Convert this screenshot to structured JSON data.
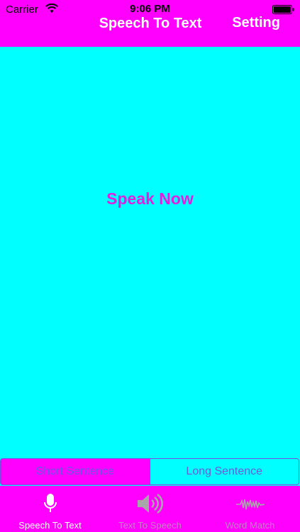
{
  "status_bar": {
    "carrier": "Carrier",
    "time": "9:06 PM"
  },
  "nav": {
    "title": "Speech To Text",
    "setting_label": "Setting"
  },
  "main": {
    "speak_now": "Speak Now"
  },
  "segmented_control": {
    "options": [
      "Short Sentence",
      "Long Sentence"
    ],
    "selected_index": 0
  },
  "tab_bar": {
    "tabs": [
      {
        "label": "Speech To Text",
        "icon": "microphone-icon",
        "selected": true
      },
      {
        "label": "Text To Speech",
        "icon": "speaker-icon",
        "selected": false
      },
      {
        "label": "Word Match",
        "icon": "waveform-icon",
        "selected": false
      }
    ]
  },
  "colors": {
    "bar": "#ff00ff",
    "background": "#00ffff",
    "accent_text": "#e020e0",
    "segment_text": "#6a5ae0"
  }
}
